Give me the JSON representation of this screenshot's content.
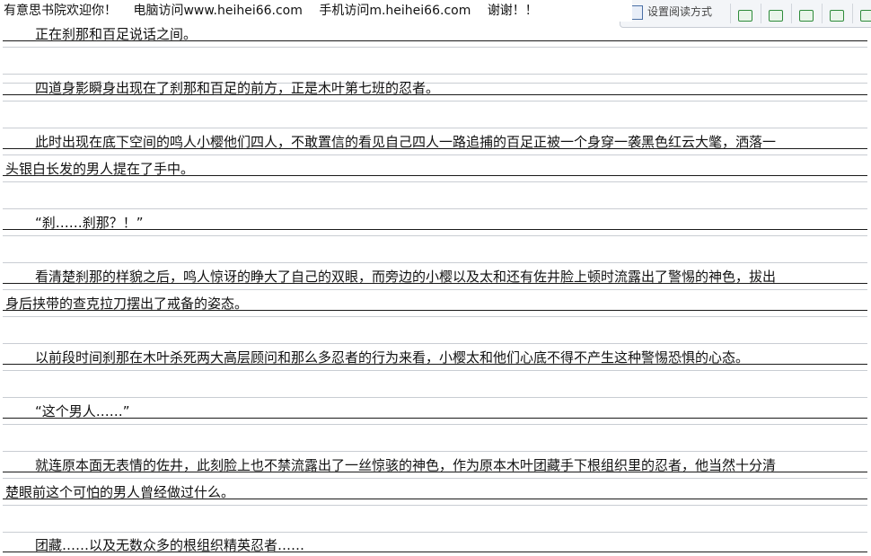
{
  "banner": {
    "welcome": "有意思书院欢迎你！",
    "pc": "电脑访问www.heihei66.com",
    "mobile": "手机访问m.heihei66.com",
    "thanks": "谢谢！！"
  },
  "toolbar": {
    "label": "设置阅读方式"
  },
  "paragraphs": [
    {
      "lines": [
        "正在刹那和百足说话之间。"
      ]
    },
    {
      "lines": [
        "四道身影瞬身出现在了刹那和百足的前方，正是木叶第七班的忍者。"
      ]
    },
    {
      "lines": [
        "此时出现在底下空间的鸣人小樱他们四人，不敢置信的看见自己四人一路追捕的百足正被一个身穿一袭黑色红云大氅，洒落一",
        "头银白长发的男人提在了手中。"
      ]
    },
    {
      "lines": [
        "“刹……刹那？！”"
      ]
    },
    {
      "lines": [
        "看清楚刹那的样貌之后，鸣人惊讶的睁大了自己的双眼，而旁边的小樱以及太和还有佐井脸上顿时流露出了警惕的神色，拔出",
        "身后挟带的查克拉刀摆出了戒备的姿态。"
      ]
    },
    {
      "lines": [
        "以前段时间刹那在木叶杀死两大高层顾问和那么多忍者的行为来看，小樱太和他们心底不得不产生这种警惕恐惧的心态。"
      ]
    },
    {
      "lines": [
        "“这个男人……”"
      ]
    },
    {
      "lines": [
        "就连原本面无表情的佐井，此刻脸上也不禁流露出了一丝惊骇的神色，作为原本木叶团藏手下根组织里的忍者，他当然十分清",
        "楚眼前这个可怕的男人曾经做过什么。"
      ]
    },
    {
      "lines": [
        "团藏……以及无数众多的根组织精英忍者……"
      ]
    }
  ]
}
